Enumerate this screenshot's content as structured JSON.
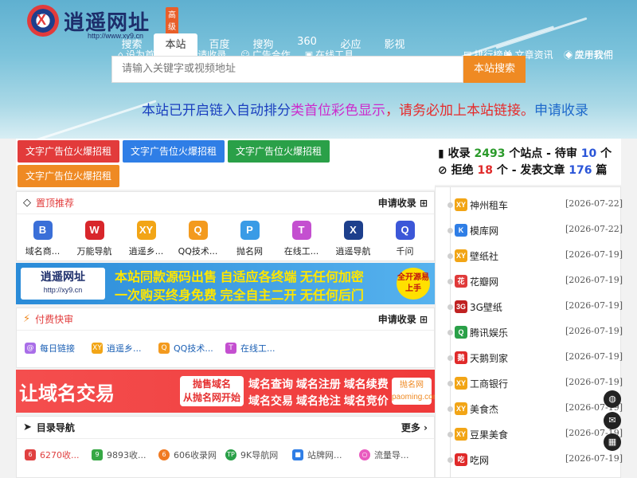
{
  "header": {
    "logo_title": "逍遥网址",
    "logo_badge": "高级版",
    "logo_url": "http://www.xy9.cn",
    "top_links": [
      {
        "icon": "home-icon",
        "label": "设为首页"
      },
      {
        "icon": "edit-icon",
        "label": "申请收录"
      },
      {
        "icon": "cooperate-icon",
        "label": "广告合作"
      },
      {
        "icon": "tool-icon",
        "label": "在线工具"
      },
      {
        "icon": "rank-icon",
        "label": "排行榜单"
      },
      {
        "icon": "article-icon",
        "label": "文章资讯"
      },
      {
        "icon": "app-icon",
        "label": "应用软件"
      },
      {
        "icon": "info-icon",
        "label": "关于我们"
      }
    ],
    "search_tabs": [
      "搜索",
      "本站",
      "百度",
      "搜狗",
      "360",
      "必应",
      "影视"
    ],
    "search_active_tab": "本站",
    "search_placeholder": "请输入关键字或视频地址",
    "search_button": "本站搜索",
    "marquee": {
      "seg1": "本站已开启链入自动排分",
      "seg2": "类首位彩色显示",
      "seg3": "，请务必加上本站链接。",
      "seg4": "申请收录"
    }
  },
  "ads": [
    {
      "label": "文字广告位火爆招租",
      "color": "#e23b3b"
    },
    {
      "label": "文字广告位火爆招租",
      "color": "#2f7ee6"
    },
    {
      "label": "文字广告位火爆招租",
      "color": "#2aa048"
    },
    {
      "label": "文字广告位火爆招租",
      "color": "#ef8a23"
    }
  ],
  "top_section": {
    "title": "置顶推荐",
    "action": "申请收录",
    "items": [
      {
        "label": "域名商...",
        "icon": "domain-icon",
        "color": "#3a6fd8",
        "glyph": "B"
      },
      {
        "label": "万能导航",
        "icon": "wanneng-icon",
        "color": "#d8262b",
        "glyph": "W"
      },
      {
        "label": "逍遥乡...",
        "icon": "xy-icon",
        "color": "#f2a516",
        "glyph": "XY"
      },
      {
        "label": "QQ技术...",
        "icon": "qq-search-icon",
        "color": "#f39a1e",
        "glyph": "Q"
      },
      {
        "label": "抛名网",
        "icon": "paoming-icon",
        "color": "#3a9be6",
        "glyph": "P"
      },
      {
        "label": "在线工...",
        "icon": "toolbox-icon",
        "color": "#c44fd0",
        "glyph": "T"
      },
      {
        "label": "逍遥导航",
        "icon": "xy-nav-icon",
        "color": "#1d3f8c",
        "glyph": "X"
      },
      {
        "label": "千问",
        "icon": "qianwen-icon",
        "color": "#3c57d8",
        "glyph": "Q"
      }
    ]
  },
  "banner1": {
    "logo_title": "逍遥网址",
    "logo_url": "http://xy9.cn",
    "line1": "本站同款源码出售 自适应各终端 无任何加密",
    "line2": "一次购买终身免费 完全自主二开 无任何后门",
    "seal": "全开源易上手"
  },
  "paid_section": {
    "title": "付费快审",
    "action": "申请收录",
    "items": [
      {
        "label": "每日链接",
        "icon": "daily-link-icon",
        "color": "#a96ee8"
      },
      {
        "label": "逍遥乡...",
        "icon": "xy-icon",
        "color": "#f2a516"
      },
      {
        "label": "QQ技术...",
        "icon": "qq-search-icon",
        "color": "#f39a1e"
      },
      {
        "label": "在线工...",
        "icon": "toolbox-icon",
        "color": "#c44fd0"
      }
    ]
  },
  "banner2": {
    "headline": "让域名交易",
    "tag_line1": "抛售域名",
    "tag_line2": "从抛名网开始",
    "row1": "域名查询 域名注册 域名续费",
    "row2": "域名交易 域名抢注 域名竞价",
    "brand_name": "抛名网",
    "brand_url": "paoming.com"
  },
  "dir_section": {
    "title": "目录导航",
    "more": "更多",
    "items": [
      {
        "label": "6270收...",
        "icon": "site-6270-icon",
        "color": "#e04040"
      },
      {
        "label": "9893收...",
        "icon": "site-9893-icon",
        "color": "#37a845"
      },
      {
        "label": "606收录网",
        "icon": "site-606-icon",
        "color": "#f07a22"
      },
      {
        "label": "9K导航网",
        "icon": "tp-icon",
        "color": "#2aa048"
      },
      {
        "label": "站牌网...",
        "icon": "cube-icon",
        "color": "#2f7ee6"
      },
      {
        "label": "流量导...",
        "icon": "ring-icon",
        "color": "#e95bbf"
      }
    ]
  },
  "stats": {
    "t1": "收录",
    "count": "2493",
    "t2": "个站点 - 待审",
    "pending": "10",
    "t3": "个",
    "t4": "拒绝",
    "rejected": "18",
    "t5": "个 - 发表文章",
    "articles": "176",
    "t6": "篇"
  },
  "latest": [
    {
      "name": "神州租车",
      "date": "[2026-07-22]",
      "icon": "xy-icon",
      "color": "#f2a516",
      "glyph": "XY"
    },
    {
      "name": "模库网",
      "date": "[2026-07-22]",
      "icon": "moku-icon",
      "color": "#2f7ee6",
      "glyph": "K"
    },
    {
      "name": "壁纸社",
      "date": "[2026-07-19]",
      "icon": "xy-icon",
      "color": "#f2a516",
      "glyph": "XY"
    },
    {
      "name": "花瓣网",
      "date": "[2026-07-19]",
      "icon": "huaban-icon",
      "color": "#e03a3a",
      "glyph": "花"
    },
    {
      "name": "3G壁纸",
      "date": "[2026-07-19]",
      "icon": "3g-icon",
      "color": "#c02222",
      "glyph": "3G"
    },
    {
      "name": "腾讯娱乐",
      "date": "[2026-07-19]",
      "icon": "tencent-icon",
      "color": "#2aa048",
      "glyph": "Q"
    },
    {
      "name": "天鹅到家",
      "date": "[2026-07-19]",
      "icon": "swan-icon",
      "color": "#e02a2a",
      "glyph": "鹅"
    },
    {
      "name": "工商银行",
      "date": "[2026-07-19]",
      "icon": "xy-icon",
      "color": "#f2a516",
      "glyph": "XY"
    },
    {
      "name": "美食杰",
      "date": "[2026-07-19]",
      "icon": "xy-icon",
      "color": "#f2a516",
      "glyph": "XY"
    },
    {
      "name": "豆果美食",
      "date": "[2026-07-19]",
      "icon": "xy-icon",
      "color": "#f2a516",
      "glyph": "XY"
    },
    {
      "name": "吃网",
      "date": "[2026-07-19]",
      "icon": "chi-icon",
      "color": "#e02a2a",
      "glyph": "吃"
    }
  ],
  "float_buttons": [
    "qq-icon",
    "mail-icon",
    "qrcode-icon"
  ]
}
